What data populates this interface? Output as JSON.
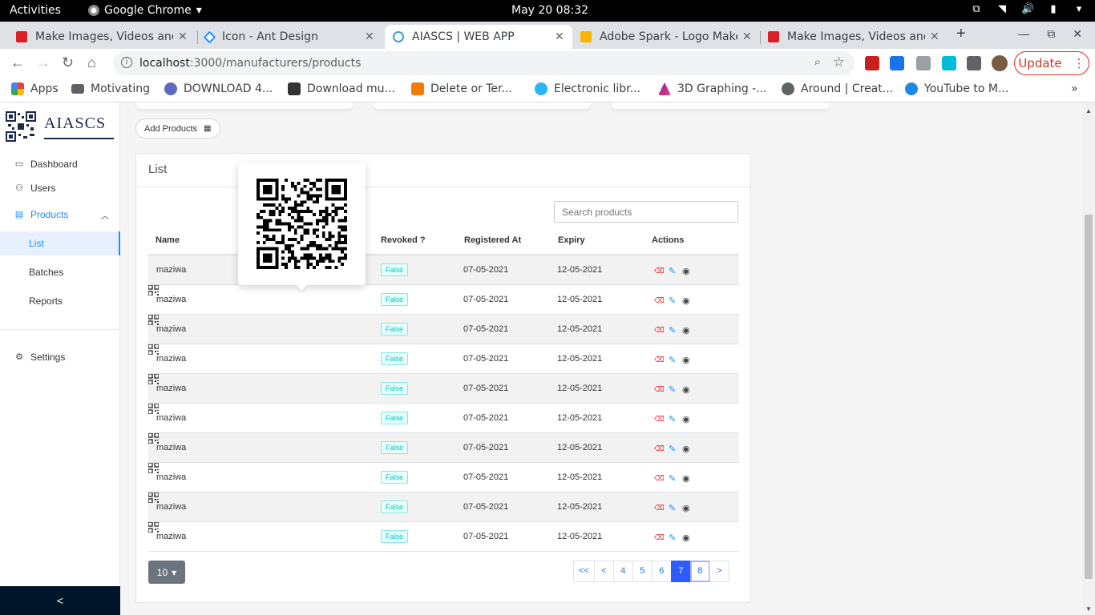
{
  "os": {
    "activities": "Activities",
    "app_name": "Google Chrome",
    "clock": "May 20  08:32"
  },
  "browser": {
    "tabs": [
      {
        "title": "Make Images, Videos and",
        "favicon_color": "#da1f26"
      },
      {
        "title": "Icon - Ant Design",
        "favicon_color": "#1890ff"
      },
      {
        "title": "AIASCS | WEB APP",
        "favicon_color": "#61dafb"
      },
      {
        "title": "Adobe Spark - Logo Make",
        "favicon_color": "#f7b500"
      },
      {
        "title": "Make Images, Videos and",
        "favicon_color": "#da1f26"
      }
    ],
    "url_host": "localhost",
    "url_path": ":3000/manufacturers/products",
    "update_label": "Update",
    "bookmarks": [
      {
        "label": "Apps",
        "icon": "apps-grid-icon"
      },
      {
        "label": "Motivating",
        "icon": "folder-icon"
      },
      {
        "label": "DOWNLOAD 4...",
        "icon": "globe-icon"
      },
      {
        "label": "Download mu...",
        "icon": "bot-icon"
      },
      {
        "label": "Delete or Ter...",
        "icon": "hexagon-icon"
      },
      {
        "label": "Electronic libr...",
        "icon": "library-icon"
      },
      {
        "label": "3D Graphing -...",
        "icon": "triangle-icon"
      },
      {
        "label": "Around | Creat...",
        "icon": "globe-icon"
      },
      {
        "label": "YouTube to M...",
        "icon": "download-cloud-icon"
      }
    ]
  },
  "sidebar": {
    "brand": "AIASCS",
    "items": [
      {
        "label": "Dashboard",
        "icon": "monitor-icon"
      },
      {
        "label": "Users",
        "icon": "user-icon"
      },
      {
        "label": "Products",
        "icon": "products-icon"
      },
      {
        "label": "List"
      },
      {
        "label": "Batches"
      },
      {
        "label": "Reports"
      },
      {
        "label": "Settings",
        "icon": "gear-icon"
      }
    ],
    "collapse_label": "<"
  },
  "toolbar": {
    "add_products_label": "Add Products"
  },
  "list": {
    "title": "List",
    "search_placeholder": "Search products",
    "columns": [
      "Name",
      "Revoked ?",
      "Registered At",
      "Expiry",
      "Actions"
    ],
    "rows": [
      {
        "name": "maziwa",
        "revoked": "False",
        "registered": "07-05-2021",
        "expiry": "12-05-2021"
      },
      {
        "name": "maziwa",
        "revoked": "False",
        "registered": "07-05-2021",
        "expiry": "12-05-2021"
      },
      {
        "name": "maziwa",
        "revoked": "False",
        "registered": "07-05-2021",
        "expiry": "12-05-2021"
      },
      {
        "name": "maziwa",
        "revoked": "False",
        "registered": "07-05-2021",
        "expiry": "12-05-2021"
      },
      {
        "name": "maziwa",
        "revoked": "False",
        "registered": "07-05-2021",
        "expiry": "12-05-2021"
      },
      {
        "name": "maziwa",
        "revoked": "False",
        "registered": "07-05-2021",
        "expiry": "12-05-2021"
      },
      {
        "name": "maziwa",
        "revoked": "False",
        "registered": "07-05-2021",
        "expiry": "12-05-2021"
      },
      {
        "name": "maziwa",
        "revoked": "False",
        "registered": "07-05-2021",
        "expiry": "12-05-2021"
      },
      {
        "name": "maziwa",
        "revoked": "False",
        "registered": "07-05-2021",
        "expiry": "12-05-2021"
      },
      {
        "name": "maziwa",
        "revoked": "False",
        "registered": "07-05-2021",
        "expiry": "12-05-2021"
      }
    ],
    "page_size": "10",
    "pager": [
      "<<",
      "<",
      "4",
      "5",
      "6",
      "7",
      "8",
      ">"
    ],
    "current_page": "7"
  }
}
